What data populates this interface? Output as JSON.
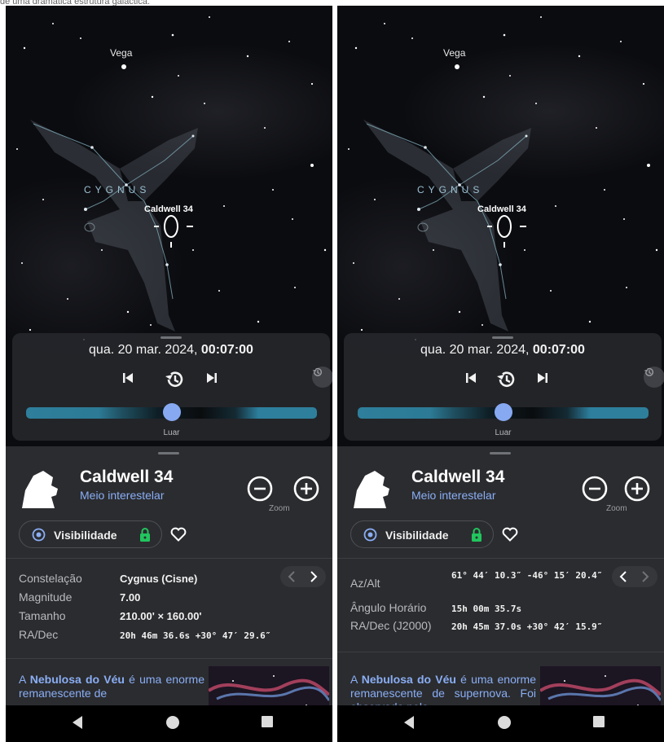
{
  "caption": "de uma dramática estrutura galáctica.",
  "sky": {
    "star_vega": "Vega",
    "constellation": "CYGNUS",
    "object_label": "Caldwell 34"
  },
  "time_panel": {
    "date": "qua. 20 mar. 2024, ",
    "time": "00:07:00",
    "slider_label": "Luar",
    "slider_value_fraction": 0.5
  },
  "object": {
    "title": "Caldwell 34",
    "type": "Meio interestelar",
    "zoom_label": "Zoom",
    "visibility_label": "Visibilidade"
  },
  "left_info": [
    {
      "label": "Constelação",
      "value": "Cygnus (Cisne)"
    },
    {
      "label": "Magnitude",
      "value": "7.00"
    },
    {
      "label": "Tamanho",
      "value": "210.00' × 160.00'"
    },
    {
      "label": "RA/Dec",
      "value": "20h 46m 36.6s   +30° 47′ 29.6″"
    }
  ],
  "right_info": [
    {
      "label": "Az/Alt",
      "value": "61° 44′ 10.3″  -46° 15′ 20.4″"
    },
    {
      "label": "Ângulo Horário",
      "value": "15h 00m 35.7s"
    },
    {
      "label": "RA/Dec (J2000)",
      "value": "20h 45m 37.0s   +30° 42′ 15.9″"
    }
  ],
  "description": {
    "prefix": "A ",
    "highlight": "Nebulosa do Véu",
    "left_text": " é uma enorme remanescente de",
    "right_text": " é uma enorme remanescente de supernova. Foi observada pela"
  },
  "colors": {
    "accent": "#8aaef5",
    "lock_green": "#22c55e",
    "slider_teal": "#2e7f9c",
    "sheet_bg": "#2b2c2f"
  },
  "icons": {
    "prev": "skip-previous-icon",
    "reset_time": "history-icon",
    "next": "skip-next-icon",
    "zoom_out": "minus-circle-icon",
    "zoom_in": "plus-circle-icon",
    "favorite": "heart-icon",
    "lock": "lock-icon"
  }
}
